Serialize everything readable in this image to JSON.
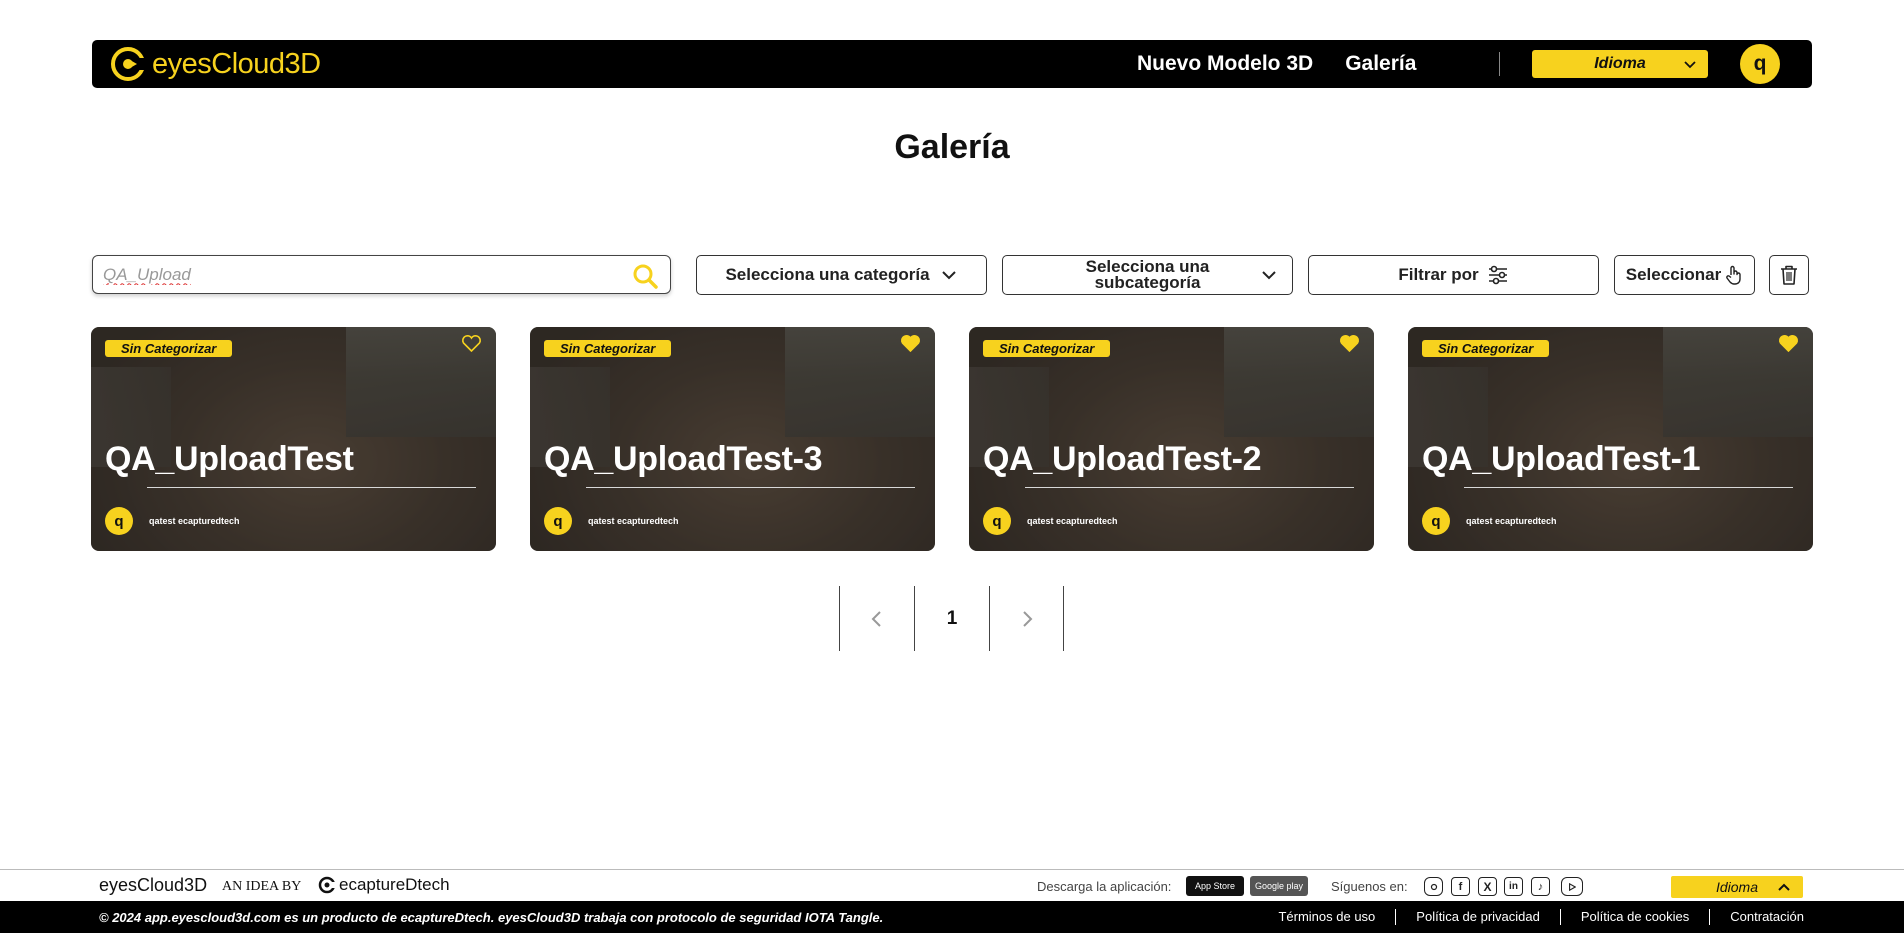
{
  "header": {
    "brand": "eyesCloud3D",
    "nav": [
      "Nuevo Modelo 3D",
      "Galería"
    ],
    "language_label": "Idioma",
    "user_initial": "q"
  },
  "main": {
    "title": "Galería",
    "search": {
      "value": "QA_Upload"
    },
    "controls": {
      "category": "Selecciona una categoría",
      "subcategory": "Selecciona una subcategoría",
      "filter": "Filtrar por",
      "select": "Seleccionar"
    },
    "cards": [
      {
        "badge": "Sin Categorizar",
        "title": "QA_UploadTest",
        "owner_initial": "q",
        "owner": "qatest ecapturedtech",
        "favorite": false
      },
      {
        "badge": "Sin Categorizar",
        "title": "QA_UploadTest-3",
        "owner_initial": "q",
        "owner": "qatest ecapturedtech",
        "favorite": true
      },
      {
        "badge": "Sin Categorizar",
        "title": "QA_UploadTest-2",
        "owner_initial": "q",
        "owner": "qatest ecapturedtech",
        "favorite": true
      },
      {
        "badge": "Sin Categorizar",
        "title": "QA_UploadTest-1",
        "owner_initial": "q",
        "owner": "qatest ecapturedtech",
        "favorite": true
      }
    ],
    "pagination": {
      "current_page": "1"
    }
  },
  "footer": {
    "brand": "eyesCloud3D",
    "idea_by": "AN IDEA BY",
    "company": "ecaptureDtech",
    "download_label": "Descarga la aplicación:",
    "app_store": "App Store",
    "google_play": "Google play",
    "follow_label": "Síguenos en:",
    "social": [
      "instagram-icon",
      "facebook-icon",
      "x-icon",
      "linkedin-icon",
      "tiktok-icon",
      "youtube-icon"
    ],
    "language_label": "Idioma",
    "copyright": "© 2024 app.eyescloud3d.com es un producto de ecaptureDtech. eyesCloud3D trabaja con protocolo de seguridad IOTA Tangle.",
    "links": [
      "Términos de uso",
      "Política de privacidad",
      "Política de cookies",
      "Contratación"
    ]
  },
  "colors": {
    "accent": "#f7d21e",
    "header_bg": "#000000"
  }
}
